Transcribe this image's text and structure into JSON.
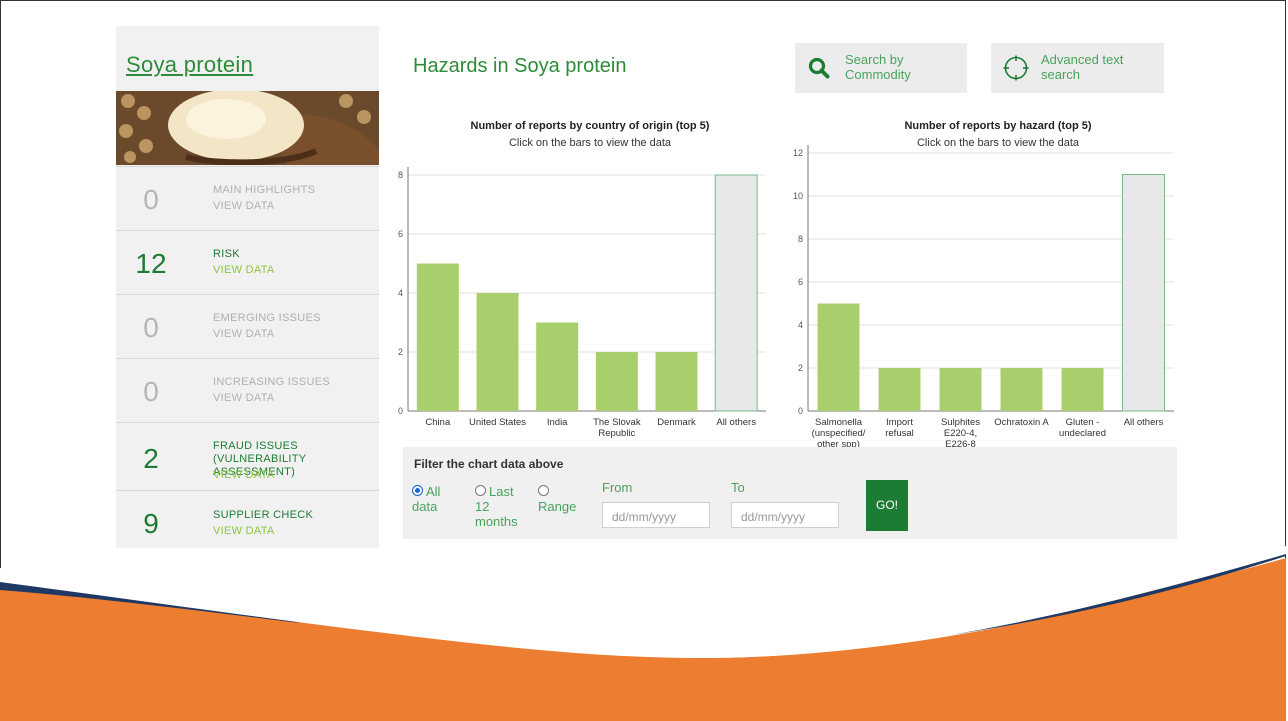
{
  "sidebar": {
    "title": "Soya protein",
    "items": [
      {
        "count": "0",
        "label": "MAIN HIGHLIGHTS",
        "link": "VIEW DATA",
        "state": "muted"
      },
      {
        "count": "12",
        "label": "RISK",
        "link": "VIEW DATA",
        "state": "active"
      },
      {
        "count": "0",
        "label": "EMERGING ISSUES",
        "link": "VIEW DATA",
        "state": "muted"
      },
      {
        "count": "0",
        "label": "INCREASING ISSUES",
        "link": "VIEW DATA",
        "state": "muted"
      },
      {
        "count": "2",
        "label": "FRAUD ISSUES (VULNERABILITY ASSESSMENT)",
        "link": "VIEW DATA",
        "state": "active"
      },
      {
        "count": "9",
        "label": "SUPPLIER CHECK",
        "link": "VIEW DATA",
        "state": "active"
      }
    ]
  },
  "header": {
    "title": "Hazards in Soya protein",
    "search_commodity": "Search by Commodity",
    "advanced_search": "Advanced text search"
  },
  "chart_data": [
    {
      "type": "bar",
      "title": "Number of reports by country of origin (top 5)",
      "subtitle": "Click on the bars to view the data",
      "categories": [
        "China",
        "United States",
        "India",
        "The Slovak Republic",
        "Denmark",
        "All others"
      ],
      "values": [
        5,
        4,
        3,
        2,
        2,
        8
      ],
      "ylim": [
        0,
        8
      ],
      "yticks": [
        0,
        2,
        4,
        6,
        8
      ],
      "grid": true,
      "colors": [
        "#a8cf6c",
        "#a8cf6c",
        "#a8cf6c",
        "#a8cf6c",
        "#a8cf6c",
        "#e8e8e8"
      ]
    },
    {
      "type": "bar",
      "title": "Number of reports by hazard (top 5)",
      "subtitle": "Click on the bars to view the data",
      "categories": [
        "Salmonella (unspecified/ other spp)",
        "Import refusal",
        "Sulphites E220-4, E226-8",
        "Ochratoxin A",
        "Gluten - undeclared",
        "All others"
      ],
      "values": [
        5,
        2,
        2,
        2,
        2,
        11
      ],
      "ylim": [
        0,
        12
      ],
      "yticks": [
        0,
        2,
        4,
        6,
        8,
        10,
        12
      ],
      "grid": true,
      "colors": [
        "#a8cf6c",
        "#a8cf6c",
        "#a8cf6c",
        "#a8cf6c",
        "#a8cf6c",
        "#e8e8e8"
      ]
    }
  ],
  "filter": {
    "title": "Filter the chart data above",
    "options": [
      "All data",
      "Last 12 months",
      "Range"
    ],
    "selected": "All data",
    "from_label": "From",
    "to_label": "To",
    "from_placeholder": "dd/mm/yyyy",
    "to_placeholder": "dd/mm/yyyy",
    "go_label": "GO!"
  },
  "colors": {
    "accent_green": "#1c7c34",
    "light_green": "#8cc63f",
    "bar_green": "#a8cf6c",
    "orange": "#ed7d31"
  }
}
